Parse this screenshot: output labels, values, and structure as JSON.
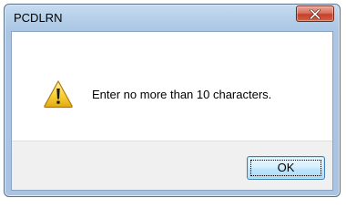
{
  "window": {
    "title": "PCDLRN"
  },
  "dialog": {
    "message": "Enter no more than 10 characters.",
    "icon": "warning-icon",
    "ok_label": "OK"
  },
  "colors": {
    "close_button": "#c7402a",
    "warning_yellow": "#f7d13a",
    "ok_button_border": "#3c7fb1",
    "title_bar": "#b7d0ea"
  }
}
